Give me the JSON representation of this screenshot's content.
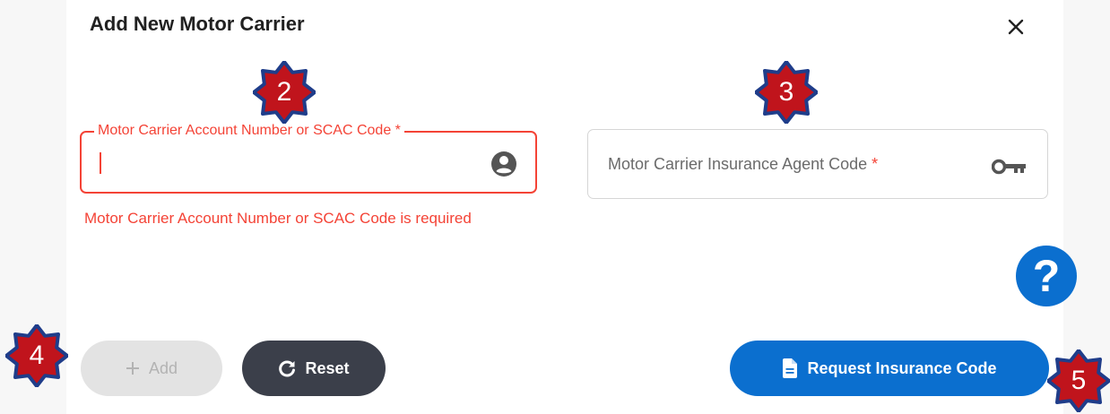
{
  "dialog": {
    "title": "Add New Motor Carrier",
    "close_icon": "close-icon"
  },
  "account_field": {
    "label": "Motor Carrier Account Number or SCAC Code *",
    "value": "",
    "icon": "person-circle-icon",
    "error": "Motor Carrier Account Number or SCAC Code is required",
    "state": "error"
  },
  "agent_field": {
    "placeholder": "Motor Carrier Insurance Agent Code",
    "required_mark": "*",
    "value": "",
    "icon": "key-icon"
  },
  "help": {
    "label": "?"
  },
  "buttons": {
    "add_label": "Add",
    "add_disabled": true,
    "reset_label": "Reset",
    "request_label": "Request Insurance Code"
  },
  "annotations": {
    "badge_2": "2",
    "badge_3": "3",
    "badge_4": "4",
    "badge_5": "5"
  },
  "colors": {
    "error": "#f44336",
    "primary": "#0b6fcf",
    "reset_bg": "#3b3f4a",
    "badge_fill": "#c0141c",
    "badge_border": "#1f3d8a"
  }
}
